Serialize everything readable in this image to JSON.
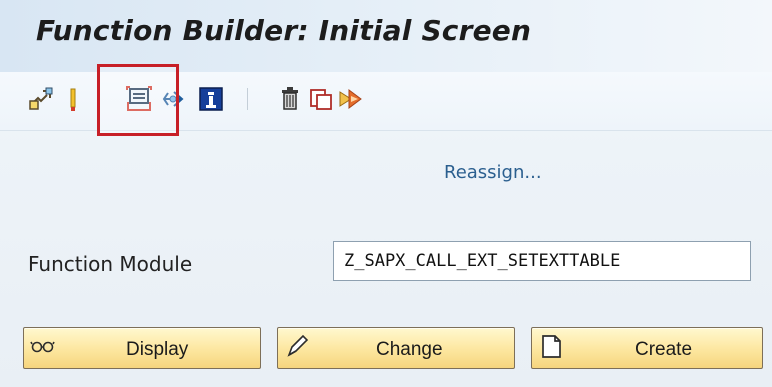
{
  "window": {
    "title": "Function Builder: Initial Screen"
  },
  "toolbar": {
    "items": [
      {
        "icon": "other-object-icon"
      },
      {
        "icon": "check-syntax-icon"
      },
      {
        "icon": "test-single-icon"
      },
      {
        "icon": "where-used-icon"
      },
      {
        "icon": "info-icon"
      },
      {
        "icon": "delete-icon"
      },
      {
        "icon": "copy-icon"
      },
      {
        "icon": "rename-icon"
      }
    ],
    "reassign_label": "Reassign...",
    "highlight_color": "#c71f27"
  },
  "form": {
    "function_module_label": "Function Module",
    "function_module_value": "Z_SAPX_CALL_EXT_SETEXTTABLE"
  },
  "buttons": {
    "display": {
      "label": "Display",
      "icon": "display-glasses-icon"
    },
    "change": {
      "label": "Change",
      "icon": "pencil-icon"
    },
    "create": {
      "label": "Create",
      "icon": "blank-page-icon"
    }
  },
  "colors": {
    "button_yellow": "#fde8a3",
    "link_blue": "#2b5f8f"
  }
}
